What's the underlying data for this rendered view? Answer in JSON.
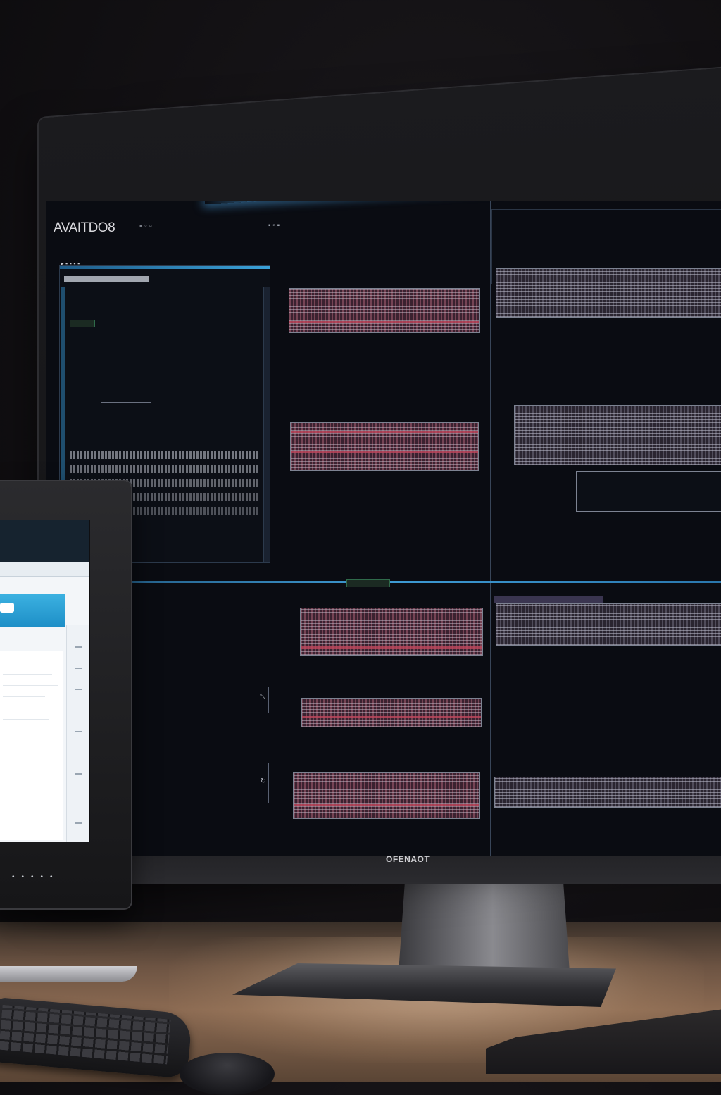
{
  "main_screen": {
    "app_title": "AVAITDO8",
    "brand_label": "OFENAOT"
  },
  "colors": {
    "accent_blue": "#3aa2d9",
    "highlight_red": "#c0485e",
    "screen_bg": "#0a0c12"
  }
}
